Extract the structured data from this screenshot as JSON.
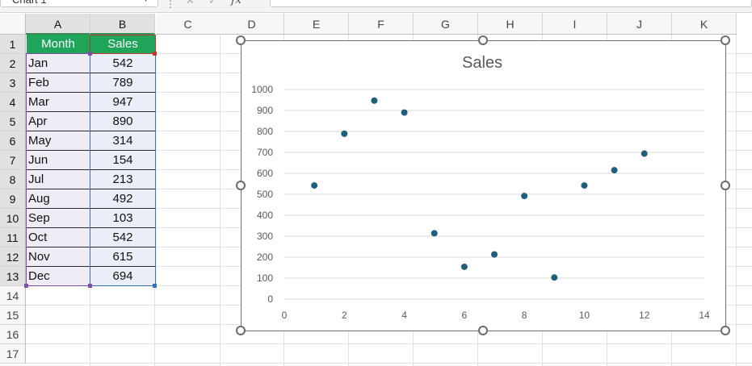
{
  "name_box": {
    "value": "Chart 1"
  },
  "formula_bar": {
    "cancel_glyph": "✕",
    "enter_glyph": "✓",
    "fx_label": "fx",
    "separator": "⋮",
    "value": ""
  },
  "columns": [
    "A",
    "B",
    "C",
    "D",
    "E",
    "F",
    "G",
    "H",
    "I",
    "J",
    "K"
  ],
  "rows": [
    "1",
    "2",
    "3",
    "4",
    "5",
    "6",
    "7",
    "8",
    "9",
    "10",
    "11",
    "12",
    "13",
    "14",
    "15",
    "16",
    "17"
  ],
  "table": {
    "headers": {
      "month": "Month",
      "sales": "Sales"
    },
    "records": [
      {
        "month": "Jan",
        "sales": "542"
      },
      {
        "month": "Feb",
        "sales": "789"
      },
      {
        "month": "Mar",
        "sales": "947"
      },
      {
        "month": "Apr",
        "sales": "890"
      },
      {
        "month": "May",
        "sales": "314"
      },
      {
        "month": "Jun",
        "sales": "154"
      },
      {
        "month": "Jul",
        "sales": "213"
      },
      {
        "month": "Aug",
        "sales": "492"
      },
      {
        "month": "Sep",
        "sales": "103"
      },
      {
        "month": "Oct",
        "sales": "542"
      },
      {
        "month": "Nov",
        "sales": "615"
      },
      {
        "month": "Dec",
        "sales": "694"
      }
    ]
  },
  "colors": {
    "header_fill": "#1fa55a",
    "marker": "#1f5f7e",
    "gridline": "#d9d9d9"
  },
  "chart_data": {
    "type": "scatter",
    "title": "Sales",
    "xlabel": "",
    "ylabel": "",
    "x": [
      1,
      2,
      3,
      4,
      5,
      6,
      7,
      8,
      9,
      10,
      11,
      12
    ],
    "y": [
      542,
      789,
      947,
      890,
      314,
      154,
      213,
      492,
      103,
      542,
      615,
      694
    ],
    "xlim": [
      0,
      14
    ],
    "ylim": [
      0,
      1000
    ],
    "x_ticks": [
      0,
      2,
      4,
      6,
      8,
      10,
      12,
      14
    ],
    "y_ticks": [
      0,
      100,
      200,
      300,
      400,
      500,
      600,
      700,
      800,
      900,
      1000
    ],
    "grid": "horizontal",
    "legend": "none"
  }
}
